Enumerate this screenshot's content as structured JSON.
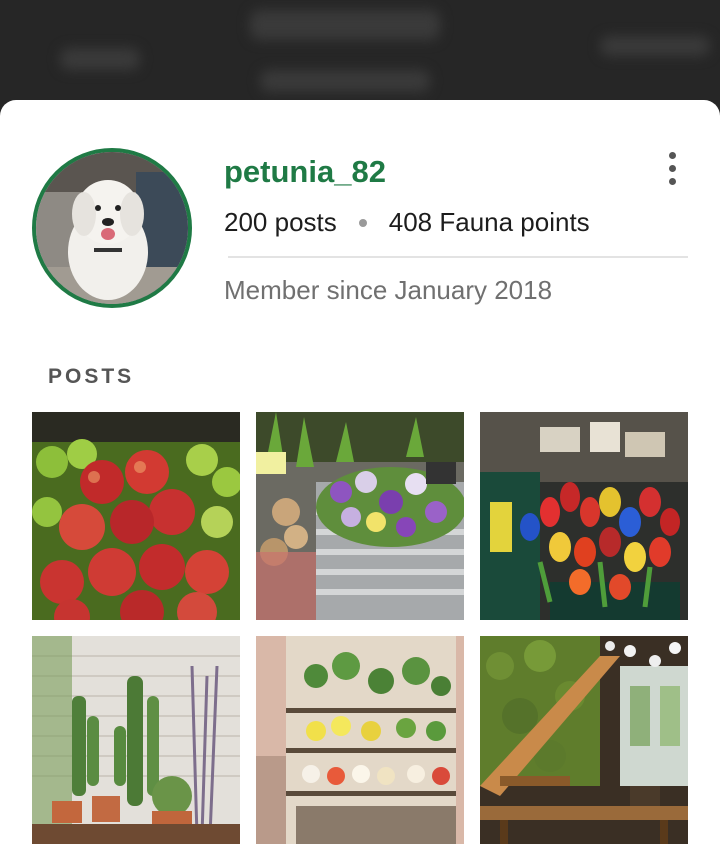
{
  "profile": {
    "username": "petunia_82",
    "posts_count": "200 posts",
    "points": "408 Fauna points",
    "member_since": "Member since January 2018",
    "accent_color": "#1f7a45",
    "avatar_icon": "dog-photo"
  },
  "menu": {
    "icon": "more-vert-icon"
  },
  "posts_section": {
    "label": "POSTS",
    "items": [
      {
        "subject": "apples-photo"
      },
      {
        "subject": "pansies-basket-photo"
      },
      {
        "subject": "tulips-market-photo"
      },
      {
        "subject": "cactus-shop-photo"
      },
      {
        "subject": "flower-shop-photo"
      },
      {
        "subject": "cafe-interior-photo"
      }
    ]
  }
}
